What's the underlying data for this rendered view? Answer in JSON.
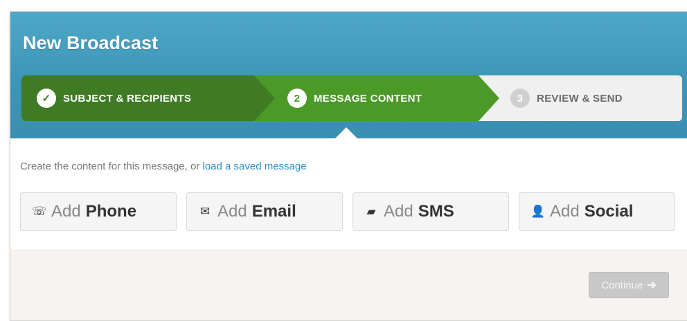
{
  "header": {
    "title": "New Broadcast"
  },
  "stepper": {
    "steps": [
      {
        "number": "✓",
        "label": "SUBJECT & RECIPIENTS",
        "state": "done"
      },
      {
        "number": "2",
        "label": "MESSAGE CONTENT",
        "state": "active"
      },
      {
        "number": "3",
        "label": "REVIEW & SEND",
        "state": "pending"
      }
    ]
  },
  "content": {
    "instruction_prefix": "Create the content for this message, or",
    "instruction_link": "load a saved message"
  },
  "add_buttons": [
    {
      "prefix": "Add",
      "label": "Phone",
      "icon": "phone-icon",
      "glyph": "☏"
    },
    {
      "prefix": "Add",
      "label": "Email",
      "icon": "envelope-icon",
      "glyph": "✉"
    },
    {
      "prefix": "Add",
      "label": "SMS",
      "icon": "speech-bubble-icon",
      "glyph": "▰"
    },
    {
      "prefix": "Add",
      "label": "Social",
      "icon": "person-icon",
      "glyph": "👤"
    }
  ],
  "footer": {
    "continue_label": "Continue",
    "continue_arrow": "➔"
  },
  "colors": {
    "header_blue": "#3d95b7",
    "step_done": "#3f7b25",
    "step_active": "#4b9a27",
    "link": "#2a8fc5",
    "continue_disabled": "#c8c8c8"
  }
}
